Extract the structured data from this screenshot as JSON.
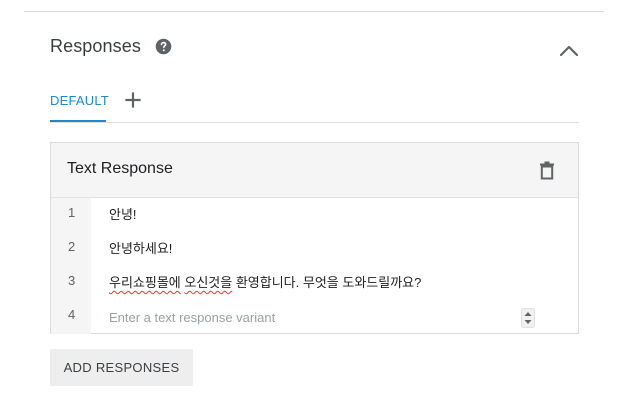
{
  "section": {
    "title": "Responses",
    "help_icon": "help-circle-icon",
    "collapse_icon": "chevron-up-icon"
  },
  "tabs": {
    "items": [
      {
        "label": "DEFAULT",
        "active": true
      }
    ],
    "add_icon": "plus-icon"
  },
  "card": {
    "title": "Text Response",
    "delete_icon": "trash-icon",
    "rows": [
      {
        "num": "1",
        "text": "안녕!"
      },
      {
        "num": "2",
        "text": "안녕하세요!"
      },
      {
        "num": "3",
        "text_parts": [
          "우리쇼핑몰에",
          " ",
          "오신것을",
          " 환영합니다. 무엇을 도와드릴까요?"
        ]
      },
      {
        "num": "4",
        "placeholder": "Enter a text response variant",
        "value": ""
      }
    ]
  },
  "add_responses_label": "ADD RESPONSES",
  "colors": {
    "accent": "#1e88c9",
    "spellcheck": "#e53935",
    "card_header_bg": "#f5f5f5",
    "button_bg": "#eeeeee"
  }
}
